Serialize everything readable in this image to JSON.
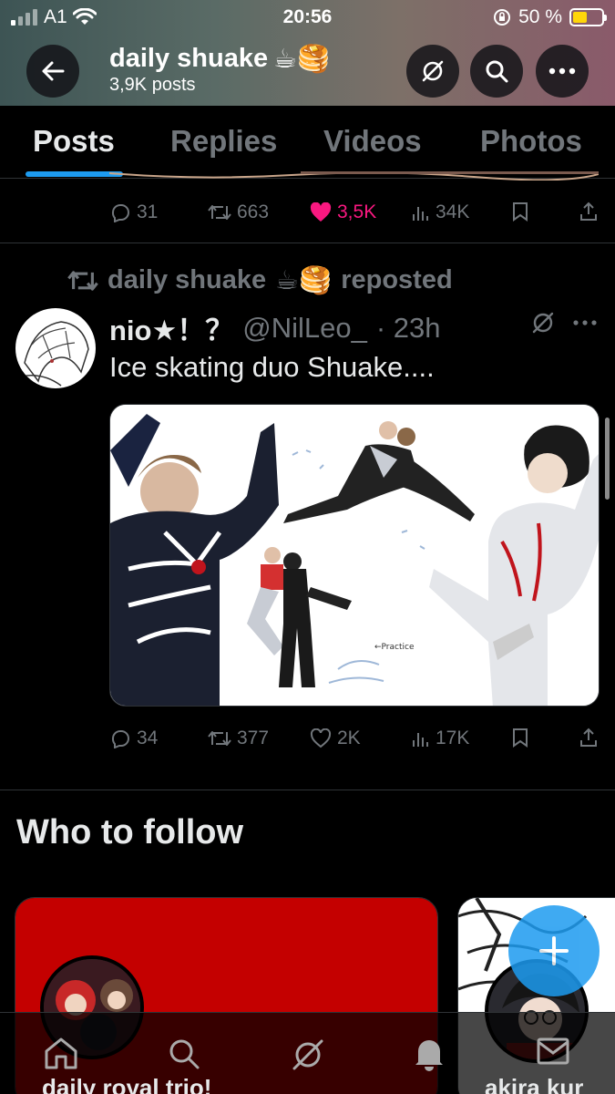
{
  "status_bar": {
    "carrier": "A1",
    "time": "20:56",
    "battery_percent": "50 %",
    "battery_level": 0.5
  },
  "header": {
    "name": "daily shuake",
    "emojis": "☕🥞",
    "post_count": "3,9K posts"
  },
  "tabs": [
    {
      "label": "Posts",
      "active": true
    },
    {
      "label": "Replies",
      "active": false
    },
    {
      "label": "Videos",
      "active": false
    },
    {
      "label": "Photos",
      "active": false
    }
  ],
  "post_1": {
    "replies": "31",
    "reposts": "663",
    "likes": "3,5K",
    "liked": true,
    "views": "34K"
  },
  "post_2": {
    "repost_by": "daily shuake",
    "repost_emojis": "☕🥞",
    "repost_suffix": "reposted",
    "author_name": "nio★！？",
    "handle": "@NilLeo_",
    "time": "· 23h",
    "text": "Ice skating duo Shuake....",
    "media_annotation": "←Practice",
    "replies": "34",
    "reposts": "377",
    "likes": "2K",
    "views": "17K"
  },
  "who_to_follow": {
    "title": "Who to follow",
    "cards": [
      {
        "label": "daily royal trio!"
      },
      {
        "label": "akira kur"
      }
    ]
  },
  "colors": {
    "accent": "#1d9bf0",
    "like": "#f91880",
    "muted": "#71767b",
    "battery": "#ffd60a"
  },
  "icons": [
    "back-arrow-icon",
    "grok-icon",
    "search-icon",
    "more-icon",
    "reply-icon",
    "repost-icon",
    "heart-icon",
    "views-icon",
    "bookmark-icon",
    "share-icon",
    "home-icon",
    "bell-icon",
    "mail-icon",
    "plus-icon"
  ]
}
